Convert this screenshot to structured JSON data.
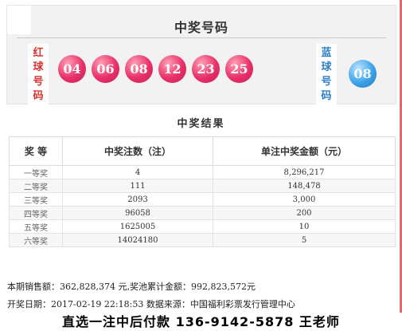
{
  "draw_panel": {
    "title": "中奖号码",
    "red_label": [
      "红",
      "球",
      "号",
      "码"
    ],
    "blue_label": [
      "蓝",
      "球",
      "号",
      "码"
    ],
    "red_balls": [
      "04",
      "06",
      "08",
      "12",
      "23",
      "25"
    ],
    "blue_ball": "08"
  },
  "results": {
    "title": "中奖结果",
    "headers": [
      "奖 等",
      "中奖注数（注）",
      "单注中奖金额（元）"
    ],
    "rows": [
      {
        "level": "一等奖",
        "count": "4",
        "amount": "8,296,217"
      },
      {
        "level": "二等奖",
        "count": "111",
        "amount": "148,478"
      },
      {
        "level": "三等奖",
        "count": "2093",
        "amount": "3,000"
      },
      {
        "level": "四等奖",
        "count": "96058",
        "amount": "200"
      },
      {
        "level": "五等奖",
        "count": "1625005",
        "amount": "10"
      },
      {
        "level": "六等奖",
        "count": "14024180",
        "amount": "5"
      }
    ]
  },
  "info": {
    "sales_label": "本期销售额：",
    "sales_value": "362,828,374 元",
    "pool_label": ",奖池累计金额：",
    "pool_value": "992,823,572元",
    "date_label": "开奖日期：",
    "date_value": "2017-02-19 22:18:53",
    "source_label": " 数据来源：",
    "source_value": "中国福利彩票发行管理中心"
  },
  "ad_text": "直选一注中后付款 136-9142-5878 王老师",
  "colors": {
    "red_ball": "#e8306a",
    "blue_ball": "#3da2ea",
    "red_label": "#d8312f",
    "blue_label": "#2f7fc8"
  }
}
